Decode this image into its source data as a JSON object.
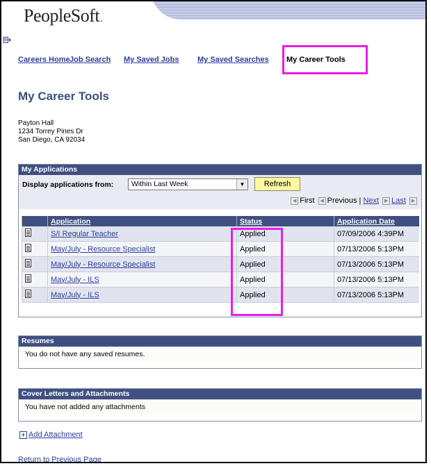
{
  "header": {
    "logo_text": "PeopleSoft",
    "logo_suffix": "."
  },
  "nav": {
    "items": [
      {
        "label": "Careers Home"
      },
      {
        "label": "Job Search"
      },
      {
        "label": "My Saved Jobs"
      },
      {
        "label": "My Saved Searches"
      }
    ],
    "current": "My Career Tools"
  },
  "page_title": "My Career Tools",
  "address": {
    "name": "Payton Hall",
    "street": "1234 Torrey Pines Dr",
    "city": "San Diego, CA 92034"
  },
  "applications": {
    "section_title": "My Applications",
    "display_label": "Display applications from:",
    "display_value": "Within Last Week",
    "refresh_label": "Refresh",
    "pager": {
      "first": "First",
      "previous": "Previous",
      "next": "Next",
      "last": "Last"
    },
    "columns": [
      "Application",
      "Status",
      "Application Date"
    ],
    "rows": [
      {
        "application": "S/I Regular Teacher",
        "status": "Applied",
        "date": "07/09/2006 4:39PM"
      },
      {
        "application": "May/July - Resource Specialist",
        "status": "Applied",
        "date": "07/13/2006 5:13PM"
      },
      {
        "application": "May/July - Resource Specialist",
        "status": "Applied",
        "date": "07/13/2006 5:13PM"
      },
      {
        "application": "May/July - ILS",
        "status": "Applied",
        "date": "07/13/2006 5:13PM"
      },
      {
        "application": "May/July - ILS",
        "status": "Applied",
        "date": "07/13/2006 5:13PM"
      }
    ]
  },
  "resumes": {
    "title": "Resumes",
    "message": "You do not have any saved resumes."
  },
  "cover_letters": {
    "title": "Cover Letters and Attachments",
    "message": "You have not added any attachments"
  },
  "add_attachment_label": "Add Attachment",
  "return_label": "Return to Previous Page",
  "colors": {
    "highlight": "#e81ce8",
    "header_bar": "#3f4f80",
    "link": "#2b3e9e",
    "button": "#fbf7a3"
  }
}
